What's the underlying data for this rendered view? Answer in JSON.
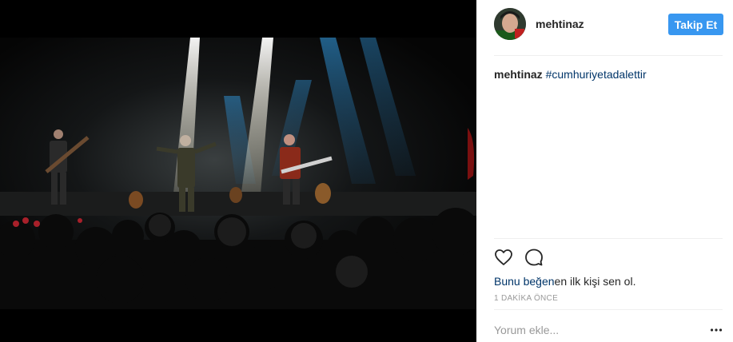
{
  "post": {
    "media_alt": "Konser sahnesi fotoğrafı",
    "username": "mehtinaz",
    "follow_label": "Takip Et",
    "caption_user": "mehtinaz",
    "caption_hashtag": "#cumhuriyetadalettir",
    "likes_link": "Bunu beğen",
    "likes_rest": "en ilk kişi sen ol.",
    "timestamp": "1 DAKİKA ÖNCE",
    "comment_placeholder": "Yorum ekle...",
    "icons": {
      "like": "heart-icon",
      "comment": "comment-icon",
      "more": "more-options-icon"
    }
  },
  "colors": {
    "follow_button": "#3897f0",
    "link": "#003569",
    "muted": "#999999"
  }
}
